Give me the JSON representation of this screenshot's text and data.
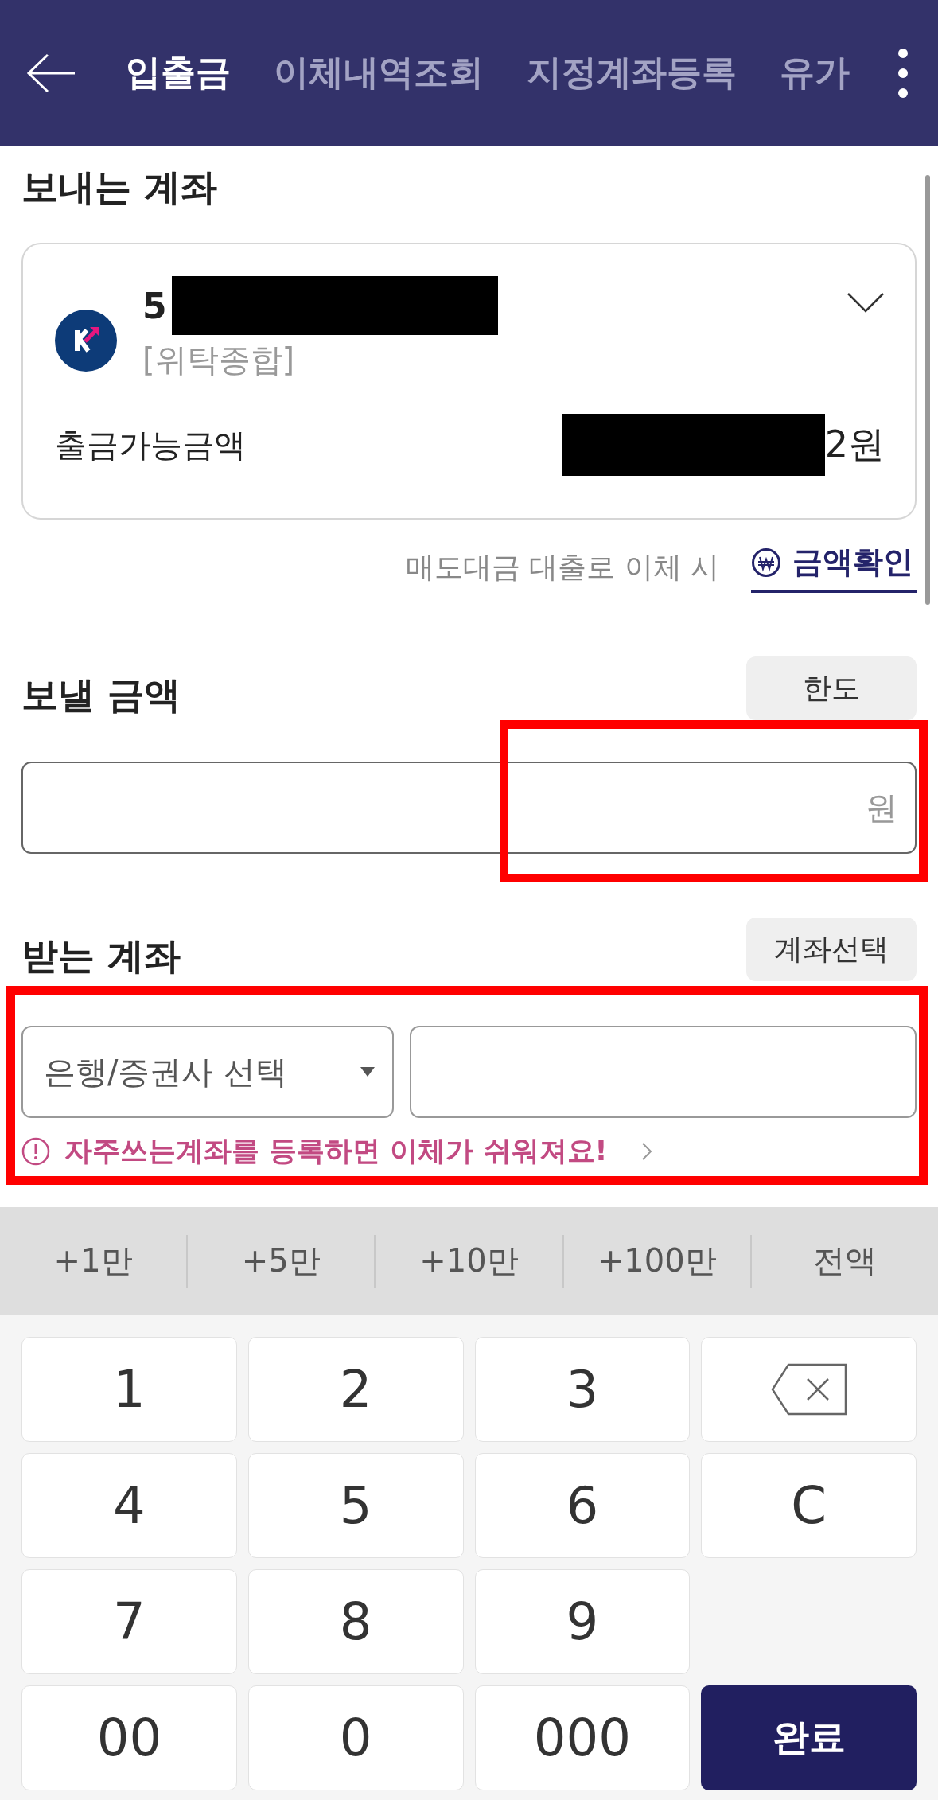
{
  "top_bar": {
    "tabs": [
      {
        "label": "입출금",
        "selected": true
      },
      {
        "label": "이체내역조회",
        "selected": false
      },
      {
        "label": "지정계좌등록",
        "selected": false
      },
      {
        "label": "유가",
        "selected": false
      }
    ]
  },
  "sending_account": {
    "title": "보내는 계좌",
    "account_number": "5",
    "number_redacted": true,
    "account_type": "[위탁종합]",
    "balance_label": "출금가능금액",
    "balance_value": "2원",
    "balance_redacted": true,
    "note": "매도대금 대출로 이체 시",
    "check_link": "금액확인"
  },
  "amount": {
    "title": "보낼 금액",
    "limit_button": "한도",
    "unit": "원",
    "highlighted": true
  },
  "receiving_account": {
    "title": "받는 계좌",
    "select_button": "계좌선택",
    "bank_select": "은행/증권사 선택",
    "notice": "자주쓰는계좌를 등록하면 이체가 쉬워져요!",
    "highlighted": true
  },
  "quick_amounts": [
    "+1만",
    "+5만",
    "+10만",
    "+100만",
    "전액"
  ],
  "keypad": [
    {
      "kind": "key",
      "label": "1"
    },
    {
      "kind": "key",
      "label": "2"
    },
    {
      "kind": "key",
      "label": "3"
    },
    {
      "kind": "backspace"
    },
    {
      "kind": "key",
      "label": "4"
    },
    {
      "kind": "key",
      "label": "5"
    },
    {
      "kind": "key",
      "label": "6"
    },
    {
      "kind": "key",
      "label": "C"
    },
    {
      "kind": "key",
      "label": "7"
    },
    {
      "kind": "key",
      "label": "8"
    },
    {
      "kind": "key",
      "label": "9"
    },
    {
      "kind": "blank"
    },
    {
      "kind": "key",
      "label": "00"
    },
    {
      "kind": "key",
      "label": "0"
    },
    {
      "kind": "key",
      "label": "000"
    },
    {
      "kind": "done",
      "label": "완료"
    }
  ]
}
